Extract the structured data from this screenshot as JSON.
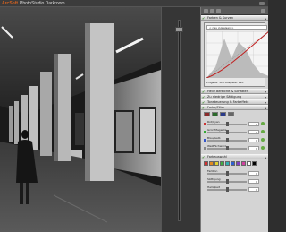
{
  "window": {
    "logo_text": "ArcSoft",
    "app_name": "PhotoStudio Darkroom"
  },
  "panel": {
    "sections": [
      {
        "label": "Farben & Kurven",
        "icon": "check-icon",
        "expanded": true
      },
      {
        "label": "Helle Bereiche & Schatten",
        "icon": "check-icon"
      },
      {
        "label": "Zu niedrige Sättigung",
        "icon": "check-icon"
      },
      {
        "label": "Tonsteuerung & Farbeffekt",
        "icon": "check-icon"
      },
      {
        "label": "Farbe/Filter",
        "icon": "check-icon",
        "expanded": true
      },
      {
        "label": "Farbauswahl",
        "icon": "check-icon",
        "expanded": true
      }
    ],
    "curve": {
      "preset_label": "< neu zuweisen >",
      "values_text": "Eingabe: 128      Ausgabe: 128"
    },
    "filter_sliders": [
      {
        "label": "Rot/Cyan",
        "value": "0",
        "swatch": "#cc3333",
        "fraction": 0.5
      },
      {
        "label": "Grün/Magenta",
        "value": "0",
        "swatch": "#33aa33",
        "fraction": 0.5
      },
      {
        "label": "Blau/Gelb",
        "value": "0",
        "swatch": "#3355cc",
        "fraction": 0.5
      },
      {
        "label": "Weiß/Schwarz",
        "value": "0",
        "swatch": "#888888",
        "fraction": 0.5
      }
    ],
    "color_sliders": [
      {
        "label": "Farbton",
        "value": "0",
        "fraction": 0.5
      },
      {
        "label": "Sättigung",
        "value": "0",
        "fraction": 0.5
      },
      {
        "label": "Helligkeit",
        "value": "0",
        "fraction": 0.5
      }
    ],
    "palette": [
      "#d03030",
      "#e08a20",
      "#e0d030",
      "#40b040",
      "#30b0b0",
      "#3060d0",
      "#8040c0",
      "#d040a0",
      "#ffffff",
      "#000000"
    ]
  }
}
